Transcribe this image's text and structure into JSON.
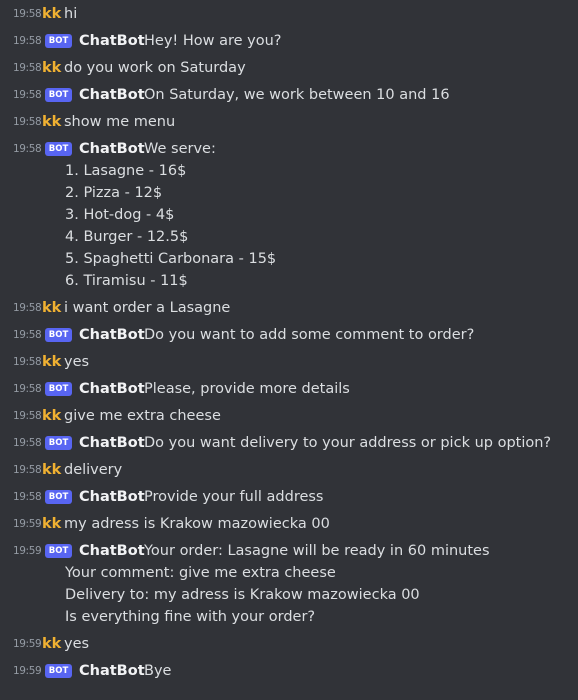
{
  "messages": [
    {
      "time": "19:58",
      "author": "kk",
      "text": "hi"
    },
    {
      "time": "19:58",
      "badge": "BOT",
      "author": "ChatBot",
      "text": "Hey! How are you?"
    },
    {
      "time": "19:58",
      "author": "kk",
      "text": "do you work on Saturday"
    },
    {
      "time": "19:58",
      "badge": "BOT",
      "author": "ChatBot",
      "text": "On Saturday, we work between 10 and 16"
    },
    {
      "time": "19:58",
      "author": "kk",
      "text": "show me menu"
    },
    {
      "time": "19:58",
      "badge": "BOT",
      "author": "ChatBot",
      "text": "We serve:",
      "lines": [
        "1. Lasagne - 16$",
        "2. Pizza - 12$",
        "3. Hot-dog - 4$",
        "4. Burger - 12.5$",
        "5. Spaghetti Carbonara - 15$",
        "6. Tiramisu - 11$"
      ]
    },
    {
      "time": "19:58",
      "author": "kk",
      "text": "i want order a Lasagne"
    },
    {
      "time": "19:58",
      "badge": "BOT",
      "author": "ChatBot",
      "text": "Do you want to add some comment to order?"
    },
    {
      "time": "19:58",
      "author": "kk",
      "text": "yes"
    },
    {
      "time": "19:58",
      "badge": "BOT",
      "author": "ChatBot",
      "text": "Please, provide more details"
    },
    {
      "time": "19:58",
      "author": "kk",
      "text": "give me extra cheese"
    },
    {
      "time": "19:58",
      "badge": "BOT",
      "author": "ChatBot",
      "text": "Do you want delivery to your address or pick up option?"
    },
    {
      "time": "19:58",
      "author": "kk",
      "text": "delivery"
    },
    {
      "time": "19:58",
      "badge": "BOT",
      "author": "ChatBot",
      "text": "Provide your full address"
    },
    {
      "time": "19:59",
      "author": "kk",
      "text": "my adress is Krakow mazowiecka 00"
    },
    {
      "time": "19:59",
      "badge": "BOT",
      "author": "ChatBot",
      "text": "Your order: Lasagne will be ready in 60 minutes",
      "lines": [
        "Your comment: give me extra cheese",
        "Delivery to: my adress is Krakow mazowiecka 00",
        "Is everything fine with your order?"
      ]
    },
    {
      "time": "19:59",
      "author": "kk",
      "text": "yes"
    },
    {
      "time": "19:59",
      "badge": "BOT",
      "author": "ChatBot",
      "text": "Bye"
    }
  ]
}
